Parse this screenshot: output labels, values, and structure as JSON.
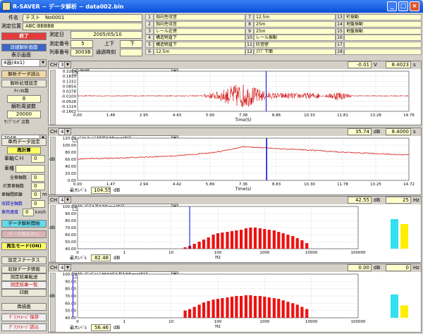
{
  "window": {
    "title": "R-SAVER − データ解析 − data002.bin",
    "controls": [
      "_",
      "□",
      "×"
    ]
  },
  "info": {
    "name_label": "件名",
    "name_value": "テスト　No0001",
    "location_label": "測定位置",
    "location_value": "ABC:BBBBB",
    "date_label": "測定日",
    "date_value": "2005/05/10",
    "number_label": "測定番号",
    "number_value": "5",
    "dir_label": "上下",
    "dir_value": "下",
    "train_label": "列車番号",
    "train_value": "3003B",
    "pass_label": "通過時刻",
    "pass_value": ""
  },
  "channels": [
    {
      "n": "1",
      "text": "指向性収音"
    },
    {
      "n": "2",
      "text": "指向性収音"
    },
    {
      "n": "3",
      "text": "レール近傍"
    },
    {
      "n": "4",
      "text": "構造物直下"
    },
    {
      "n": "5",
      "text": "構造物直下"
    },
    {
      "n": "6",
      "text": "12.5m"
    },
    {
      "n": "7",
      "text": "12.5m"
    },
    {
      "n": "8",
      "text": "25m"
    },
    {
      "n": "9",
      "text": "25m"
    },
    {
      "n": "10",
      "text": "レール振動"
    },
    {
      "n": "11",
      "text": "防音壁"
    },
    {
      "n": "12",
      "text": "ｽﾗﾌﾞ下面"
    },
    {
      "n": "13",
      "text": "桁振動"
    },
    {
      "n": "14",
      "text": "地盤振動"
    },
    {
      "n": "15",
      "text": "地盤振動"
    },
    {
      "n": "16",
      "text": ""
    },
    {
      "n": "17",
      "text": ""
    },
    {
      "n": "18",
      "text": ""
    }
  ],
  "sidebar": {
    "end": "終了",
    "detail": "詳細解析画面",
    "display_screen": "表示画面",
    "screen_select": "4画(4x1)",
    "read_data": "解析データ読込",
    "analysis_settings": "解析処理設定",
    "ch_count_label": "ﾁｬﾝﾈﾙ数",
    "ch_count": "8",
    "freq_settings": "解析周波数",
    "freq_value": "20000",
    "sampling_label": "ｻﾝﾌﾟﾘﾝｸﾞ点数",
    "sampling_value": "2048",
    "wheel_settings": "車両データ設定",
    "recalc": "再計算",
    "wheel_ch_label": "車軸ＣＨ",
    "wheel_ch": "0",
    "wheel_label": "車種",
    "wheel": "",
    "axle_total_label": "全車軸数",
    "axle_total": "0",
    "calc_axle_label": "計算車軸数",
    "calc_axle": "0",
    "axle_dist_label": "車軸間距離",
    "axle_dist": "0",
    "axle_dist_unit": "m",
    "wheel_speed_label": "収録全軸数",
    "wheel_speed": "0",
    "train_speed_label": "車両速度",
    "train_speed": "0",
    "train_speed_unit": "km/h",
    "start_analysis": "データ解析開始",
    "stop_analysis": "データ解析停止",
    "replay": "再生モード(ON)",
    "settings_status": "設定ステータス",
    "record_info": "収録データ情報",
    "result_save": "測定結果転送",
    "result_list": "測定結果一覧",
    "print": "印刷",
    "redraw": "再描画",
    "graph_save": "ｸﾞﾗﾌｲﾒｰｼﾞ保存",
    "graph_read": "ｸﾞﾗﾌｲﾒｰｼﾞ読込"
  },
  "panels": [
    {
      "ch_label": "CH",
      "ch": "3",
      "title": "全時間",
      "cursor_val": "-0.01",
      "cursor_unit": "V",
      "cursor_x": "8.4023",
      "cursor_x_unit": "s"
    },
    {
      "ch_label": "CH",
      "ch": "4",
      "title": "ﾚﾍﾞﾙﾚｺｰﾄﾞ[F][125ms(F)]",
      "cursor_val": "35.74",
      "cursor_unit": "dB",
      "cursor_x": "8.4000",
      "cursor_x_unit": "s",
      "max_label": "最大ﾚﾍﾞﾙ",
      "max_value": "104.55",
      "max_unit": "dB"
    },
    {
      "ch_label": "CH",
      "ch": "4",
      "title": "ｵｸﾀｰﾌﾞ[A][125ms(F)]",
      "cursor_val": "42.55",
      "cursor_unit": "dB",
      "cursor_x": "25",
      "cursor_x_unit": "Hz",
      "max_label": "最大ﾚﾍﾞﾙ",
      "max_value": "82.48",
      "max_unit": "dB"
    },
    {
      "ch_label": "CH",
      "ch": "4",
      "title": "ｵｸﾀｰﾌﾞﾊﾞﾝﾄﾞMAX[A][125ms(F)]",
      "cursor_val": "0.00",
      "cursor_unit": "dB",
      "cursor_x": "0",
      "cursor_x_unit": "Hz",
      "max_label": "最大ﾚﾍﾞﾙ",
      "max_value": "56.46",
      "max_unit": "dB"
    }
  ],
  "chart_data": [
    {
      "type": "line",
      "xlabel": "Time(S)",
      "ylabel": "",
      "xlim": [
        0,
        14.76
      ],
      "ylim": [
        -0.1602,
        0.2288
      ],
      "x_ticks": [
        "0.00",
        "1.48",
        "2.95",
        "4.43",
        "5.90",
        "7.38",
        "8.86",
        "10.33",
        "11.81",
        "13.28",
        "14.76"
      ],
      "y_ticks": [
        "0.2288",
        "0.1810",
        "0.1332",
        "0.0854",
        "0.0378",
        "-0.0100",
        "-0.0628",
        "-0.1114",
        "-0.1602"
      ],
      "cursor_x": 8.4023
    },
    {
      "type": "line",
      "xlabel": "Time(s)",
      "ylabel": "dB",
      "xlim": [
        0,
        14.72
      ],
      "ylim": [
        0,
        120
      ],
      "x_ticks": [
        "0.00",
        "1.47",
        "2.94",
        "4.42",
        "5.89",
        "7.36",
        "8.83",
        "10.30",
        "11.78",
        "13.25",
        "14.72"
      ],
      "y_ticks": [
        "120.00",
        "100.00",
        "80.00",
        "60.00",
        "40.00",
        "20.00",
        "0.00"
      ],
      "x": [
        0,
        1.47,
        2.94,
        4.42,
        5.89,
        6.5,
        7.36,
        8.4,
        8.83,
        10.3,
        11.78,
        13.25,
        14.72
      ],
      "y": [
        61,
        63,
        66,
        70,
        78,
        84,
        96,
        92,
        90,
        86,
        80,
        76,
        72
      ],
      "cursor_x": 8.4
    },
    {
      "type": "bar",
      "xlabel": "Hz",
      "ylabel": "dB",
      "ylim": [
        40,
        100
      ],
      "xscale": "log",
      "x_ticks": [
        "0",
        "1",
        "10",
        "100",
        "1000",
        "10000",
        "100000"
      ],
      "y_ticks": [
        "100.00",
        "90.00",
        "80.00",
        "70.00",
        "60.00",
        "50.00",
        "40.00"
      ],
      "x": [
        20,
        25,
        31.5,
        40,
        50,
        63,
        80,
        100,
        125,
        160,
        200,
        250,
        315,
        400,
        500,
        630,
        800,
        1000,
        1250,
        1600,
        2000,
        2500,
        3150,
        4000,
        5000,
        6300,
        8000
      ],
      "values": [
        42,
        44,
        47,
        50,
        53,
        56,
        60,
        62,
        63,
        64,
        65,
        66,
        67,
        69,
        70,
        70,
        69,
        68,
        67,
        66,
        64,
        62,
        60,
        58,
        55,
        52,
        48
      ],
      "cursor_x": 25,
      "overall": [
        {
          "name": "cyan",
          "value": 82
        },
        {
          "name": "yellow",
          "value": 75
        }
      ]
    },
    {
      "type": "bar",
      "xlabel": "Hz",
      "ylabel": "dB",
      "ylim": [
        40,
        100
      ],
      "xscale": "log",
      "x_ticks": [
        "0",
        "1",
        "10",
        "100",
        "1000",
        "10000",
        "100000"
      ],
      "y_ticks": [
        "100.00",
        "90.00",
        "80.00",
        "70.00",
        "60.00",
        "50.00",
        "40.00"
      ],
      "x": [
        20,
        25,
        31.5,
        40,
        50,
        63,
        80,
        100,
        125,
        160,
        200,
        250,
        315,
        400,
        500,
        630,
        800,
        1000,
        1250,
        1600,
        2000,
        2500,
        3150,
        4000,
        5000,
        6300,
        8000
      ],
      "values": [
        50,
        52,
        55,
        58,
        61,
        63,
        65,
        66,
        67,
        68,
        69,
        70,
        70,
        71,
        71,
        70,
        70,
        69,
        68,
        67,
        66,
        64,
        62,
        60,
        58,
        55,
        52
      ],
      "cursor_x": 0.08,
      "overall": [
        {
          "name": "cyan",
          "value": 72
        },
        {
          "name": "yellow",
          "value": 57
        }
      ]
    }
  ]
}
